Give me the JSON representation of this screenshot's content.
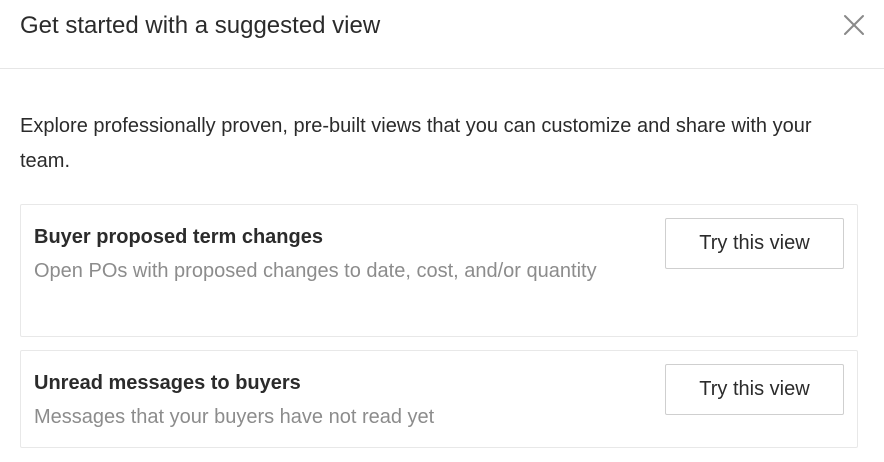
{
  "header": {
    "title": "Get started with a suggested view",
    "close_icon": "close-icon"
  },
  "intro": {
    "text": "Explore professionally proven, pre-built views that you can customize and share with your team."
  },
  "views": [
    {
      "title": "Buyer proposed term changes",
      "description": "Open POs with proposed changes to date, cost, and/or quantity",
      "button_label": "Try this view"
    },
    {
      "title": "Unread messages to buyers",
      "description": "Messages that your buyers have not read yet",
      "button_label": "Try this view"
    }
  ]
}
